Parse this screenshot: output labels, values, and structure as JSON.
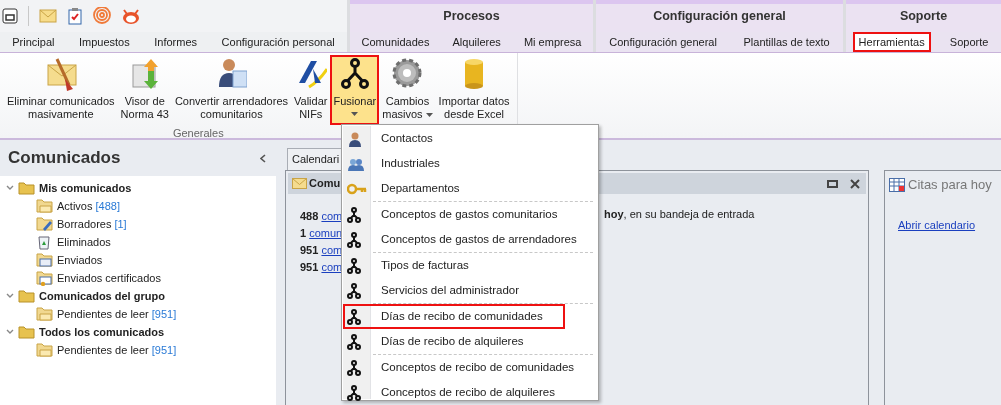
{
  "context_headers": [
    {
      "label": "Procesos"
    },
    {
      "label": "Configuración general"
    },
    {
      "label": "Soporte"
    }
  ],
  "tab_groups": [
    {
      "tabs": [
        {
          "label": "Principal",
          "selected": false
        },
        {
          "label": "Impuestos",
          "selected": false
        },
        {
          "label": "Informes",
          "selected": false
        },
        {
          "label": "Configuración personal",
          "selected": false
        }
      ]
    },
    {
      "tabs": [
        {
          "label": "Comunidades",
          "selected": false
        },
        {
          "label": "Alquileres",
          "selected": false
        },
        {
          "label": "Mi empresa",
          "selected": false
        }
      ]
    },
    {
      "tabs": [
        {
          "label": "Configuración general",
          "selected": false
        },
        {
          "label": "Plantillas de texto",
          "selected": false
        }
      ]
    },
    {
      "tabs": [
        {
          "label": "Herramientas",
          "selected": true
        },
        {
          "label": "Soporte",
          "selected": false
        }
      ]
    }
  ],
  "ribbon": {
    "group_label": "Generales",
    "buttons": [
      {
        "kind": "broom",
        "lines": [
          "Eliminar comunicados",
          "masivamente"
        ],
        "dropdown": false,
        "selected": false
      },
      {
        "kind": "norma",
        "lines": [
          "Visor de",
          "Norma 43"
        ],
        "dropdown": false,
        "selected": false
      },
      {
        "kind": "person",
        "lines": [
          "Convertir arrendadores",
          "comunitarios"
        ],
        "dropdown": false,
        "selected": false
      },
      {
        "kind": "agency",
        "lines": [
          "Validar",
          "NIFs"
        ],
        "dropdown": false,
        "selected": false
      },
      {
        "kind": "merge",
        "lines": [
          "Fusionar"
        ],
        "dropdown": true,
        "selected": true
      },
      {
        "kind": "gear",
        "lines": [
          "Cambios",
          "masivos"
        ],
        "dropdown": true,
        "selected": false
      },
      {
        "kind": "database",
        "lines": [
          "Importar datos",
          "desde Excel"
        ],
        "dropdown": false,
        "selected": false
      }
    ]
  },
  "sidebar": {
    "title": "Comunicados",
    "tree": [
      {
        "label": "Mis comunicados",
        "kind": "folder",
        "expanded": true,
        "children": [
          {
            "label": "Activos",
            "count": "[488]",
            "kind": "mail-folder"
          },
          {
            "label": "Borradores",
            "count": "[1]",
            "kind": "draft-folder"
          },
          {
            "label": "Eliminados",
            "kind": "bin"
          },
          {
            "label": "Enviados",
            "kind": "sent-folder"
          },
          {
            "label": "Enviados certificados",
            "kind": "cert-folder"
          }
        ]
      },
      {
        "label": "Comunicados del grupo",
        "kind": "folder",
        "expanded": true,
        "children": [
          {
            "label": "Pendientes de leer",
            "count": "[951]",
            "kind": "mail-folder"
          }
        ]
      },
      {
        "label": "Todos los comunicados",
        "kind": "folder",
        "expanded": true,
        "children": [
          {
            "label": "Pendientes de leer",
            "count": "[951]",
            "kind": "mail-folder"
          }
        ]
      }
    ]
  },
  "main_tab": {
    "label": "Calendari"
  },
  "panel": {
    "title": "Comu",
    "lines": [
      {
        "number": "488",
        "link": "com"
      },
      {
        "number": "1",
        "link": "comun"
      },
      {
        "number": "951",
        "link": "com"
      },
      {
        "number": "951",
        "link": "com"
      }
    ],
    "right_text": "**hoy**, en su bandeja de entrada"
  },
  "appointments": {
    "title": "Citas para hoy",
    "link": "Abrir calendario"
  },
  "menu": [
    {
      "label": "Contactos",
      "kind": "person",
      "divider_above": false,
      "selected": false
    },
    {
      "label": "Industriales",
      "kind": "people",
      "divider_above": false,
      "selected": false
    },
    {
      "label": "Departamentos",
      "kind": "key",
      "divider_above": false,
      "selected": false
    },
    {
      "label": "Conceptos de gastos comunitarios",
      "kind": "merge",
      "divider_above": true,
      "selected": false
    },
    {
      "label": "Conceptos de gastos de arrendadores",
      "kind": "merge",
      "divider_above": false,
      "selected": false
    },
    {
      "label": "Tipos de facturas",
      "kind": "merge",
      "divider_above": true,
      "selected": false
    },
    {
      "label": "Servicios del administrador",
      "kind": "merge",
      "divider_above": false,
      "selected": false
    },
    {
      "label": "Días de recibo de comunidades",
      "kind": "merge",
      "divider_above": true,
      "selected": true
    },
    {
      "label": "Días de recibo de alquileres",
      "kind": "merge",
      "divider_above": false,
      "selected": false
    },
    {
      "label": "Conceptos de recibo de comunidades",
      "kind": "merge",
      "divider_above": true,
      "selected": false
    },
    {
      "label": "Conceptos de recibo de alquileres",
      "kind": "merge",
      "divider_above": false,
      "selected": false
    }
  ]
}
